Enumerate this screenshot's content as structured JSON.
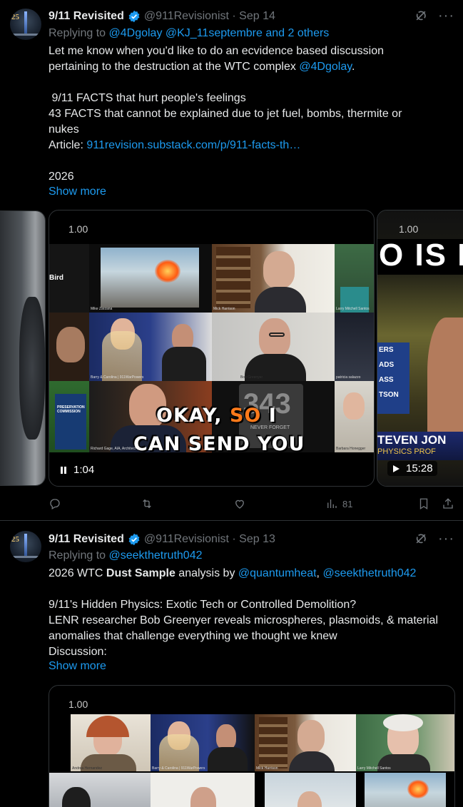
{
  "tweets": [
    {
      "author_name": "9/11 Revisited",
      "handle": "@911Revisionist",
      "date": "Sep 14",
      "replying_prefix": "Replying to",
      "replying_to": "@4Dgolay @KJ_11septembre and 2 others",
      "body": {
        "line1": "Let me know when you'd like to do an ecvidence based discussion",
        "line2_text": "pertaining to the destruction at the WTC complex ",
        "line2_mention": "@4Dgolay",
        "line2_end": ".",
        "line3": " 9/11 FACTS that hurt people's feelings",
        "line4": "43 FACTS that cannot be explained due to jet fuel, bombs, thermite or",
        "line5": "nukes",
        "article_label": "Article: ",
        "article_link": "911revision.substack.com/p/911-facts-th…",
        "year": "2026"
      },
      "show_more": "Show more",
      "video": {
        "speed": "1.00",
        "caption_pre": "OKAY, ",
        "caption_hl": "SO",
        "caption_post": " I",
        "caption_line2": "CAN SEND YOU",
        "duration": "1:04",
        "tile_names": [
          "Bird",
          "Mike Zarzana",
          "Mick Harrison",
          "Larry Mitchell Santos",
          "Barry & Carolina | 911WarPowers",
          "Bob Greenyer",
          "patricia salazzo",
          "Richard Gage, AIA, Architect",
          "Barbara Honegger"
        ],
        "overlay_number": "343",
        "overlay_sub": "NEVER FORGET",
        "book_text": "PRESERVATION COMMISSION"
      },
      "side_video": {
        "speed": "1.00",
        "title_text": "O IS I",
        "lower_third": "TEVEN JON",
        "lower_sub": "PHYSICS PROF",
        "duration": "15:28",
        "list": [
          "ERS",
          "ADS",
          "ASS",
          "TSON"
        ]
      },
      "views": "81"
    },
    {
      "author_name": "9/11 Revisited",
      "handle": "@911Revisionist",
      "date": "Sep 13",
      "replying_prefix": "Replying to",
      "replying_to": "@seekthetruth042",
      "body": {
        "l1_pre": "2026 WTC ",
        "l1_bold": "Dust Sample",
        "l1_mid": " analysis by ",
        "l1_m1": "@quantumheat",
        "l1_comma": ", ",
        "l1_m2": "@seekthetruth042",
        "l2": "9/11's Hidden Physics: Exotic Tech or Controlled Demolition?",
        "l3": "LENR researcher Bob Greenyer reveals microspheres, plasmoids, & material",
        "l4": "anomalies that challenge everything we thought we knew",
        "l5": "Discussion:"
      },
      "show_more": "Show more",
      "video": {
        "speed": "1.00",
        "tile_names": [
          "Andrea Hernandez",
          "Barry & Carolina | 911WarPowers",
          "Mick Harrison",
          "Larry Mitchell Santos"
        ]
      }
    }
  ],
  "colors": {
    "link": "#1d9bf0",
    "muted": "#71767b",
    "text": "#e7e9ea",
    "border": "#2f3336",
    "caption_highlight": "#ff7a1a"
  },
  "icons": [
    "verified-badge-icon",
    "grok-icon",
    "more-icon",
    "reply-icon",
    "retweet-icon",
    "like-icon",
    "views-icon",
    "bookmark-icon",
    "share-icon",
    "pause-icon",
    "play-icon"
  ]
}
